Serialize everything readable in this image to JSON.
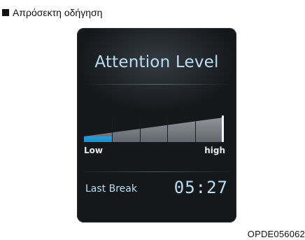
{
  "caption": {
    "text": "Απρόσεκτη οδήγηση"
  },
  "display": {
    "title": "Attention Level",
    "gauge": {
      "level_fraction": 0.2,
      "segments": 5,
      "fill_color": "#2aa8e6",
      "low_label": "Low",
      "high_label": "high"
    },
    "last_break": {
      "label": "Last Break",
      "time": "05:27"
    }
  },
  "footer": {
    "code": "OPDE056062"
  }
}
